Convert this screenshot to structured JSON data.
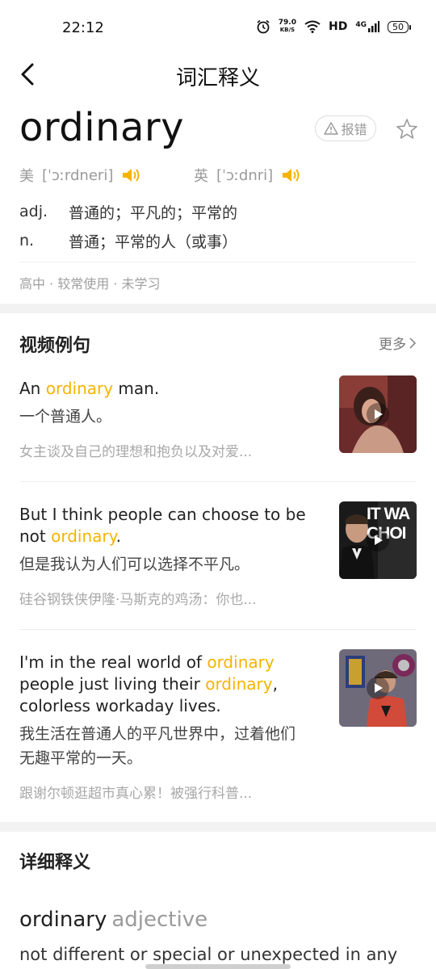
{
  "status_bar": {
    "time": "22:12",
    "net_speed_value": "79.0",
    "net_speed_unit": "KB/S",
    "hd": "HD",
    "network": "4G",
    "battery": "50"
  },
  "nav": {
    "title": "词汇释义",
    "back_icon": "chevron-left-icon"
  },
  "word": {
    "headword": "ordinary",
    "report_label": "报错",
    "us_label": "美",
    "us_phonetic": "[ˈɔːrdneri]",
    "uk_label": "英",
    "uk_phonetic": "[ˈɔːdnri]",
    "definitions": [
      {
        "pos": "adj.",
        "text": "普通的；平凡的；平常的"
      },
      {
        "pos": "n.",
        "text": "普通；平常的人（或事）"
      }
    ],
    "tags": "高中 · 较常使用 · 未学习"
  },
  "video_examples": {
    "title": "视频例句",
    "more_label": "更多",
    "items": [
      {
        "en_parts": [
          "An ",
          "ordinary",
          " man."
        ],
        "zh": "一个普通人。",
        "source": "女主谈及自己的理想和抱负以及对爱..."
      },
      {
        "en_parts": [
          "But I think people can choose to be not ",
          "ordinary",
          "."
        ],
        "zh": "但是我认为人们可以选择不平凡。",
        "source": "硅谷钢铁侠伊隆·马斯克的鸡汤：你也...",
        "thumb_text": "IT WA CHOI"
      },
      {
        "en_parts": [
          "I'm in the real world of ",
          "ordinary",
          " people just living their ",
          "ordinary",
          ", colorless workaday lives."
        ],
        "zh": "我生活在普通人的平凡世界中，过着他们无趣平常的一天。",
        "source": "跟谢尔顿逛超市真心累！被强行科普..."
      }
    ]
  },
  "detailed": {
    "title": "详细释义",
    "word": "ordinary",
    "pos": "adjective",
    "definition": "not different or special or unexpected in any"
  },
  "colors": {
    "highlight": "#f5b400",
    "speaker": "#f5b400"
  }
}
